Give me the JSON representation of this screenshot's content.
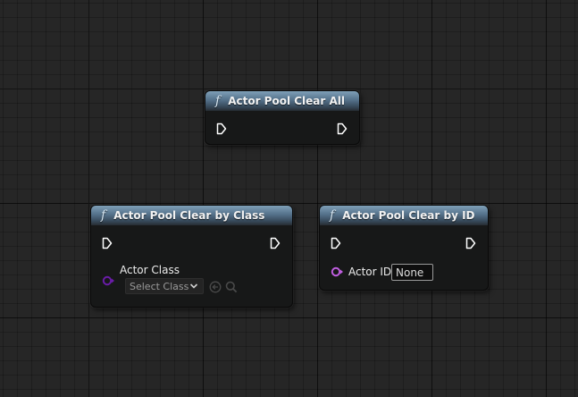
{
  "nodes": {
    "clear_all": {
      "title": "Actor Pool Clear All",
      "func_glyph": "f"
    },
    "clear_by_class": {
      "title": "Actor Pool Clear by Class",
      "func_glyph": "f",
      "param_label": "Actor Class",
      "select_value": "Select Class"
    },
    "clear_by_id": {
      "title": "Actor Pool Clear by ID",
      "func_glyph": "f",
      "param_label": "Actor ID",
      "field_value": "None"
    }
  },
  "colors": {
    "header_blue": "#54718a",
    "class_pin": "#6a1ca8",
    "object_pin": "#c05ee0",
    "exec_pin": "#ffffff"
  }
}
